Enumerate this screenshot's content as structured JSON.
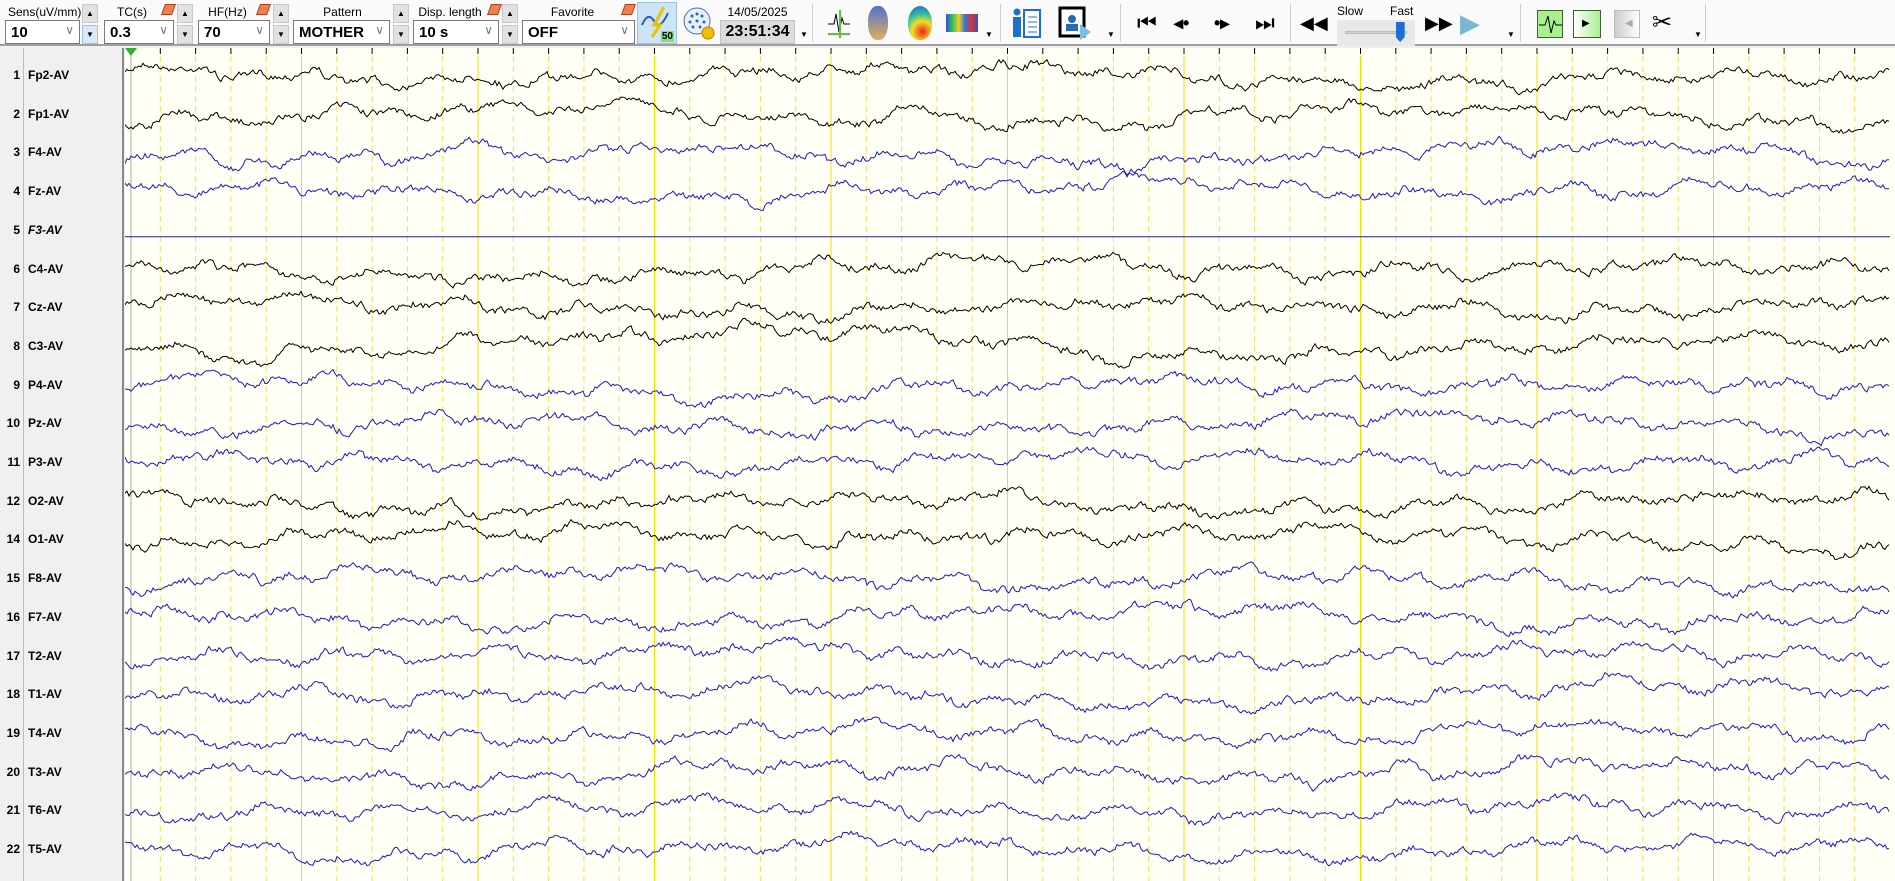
{
  "toolbar": {
    "sens": {
      "label": "Sens(uV/mm)",
      "value": "10"
    },
    "tc": {
      "label": "TC(s)",
      "value": "0.3"
    },
    "hf": {
      "label": "HF(Hz)",
      "value": "70"
    },
    "pattern": {
      "label": "Pattern",
      "value": "MOTHER"
    },
    "disp_length": {
      "label": "Disp. length",
      "value": "10 s"
    },
    "favorite": {
      "label": "Favorite",
      "value": "OFF"
    },
    "notch_badge": "50",
    "date": "14/05/2025",
    "time": "23:51:34",
    "speed": {
      "slow_label": "Slow",
      "fast_label": "Fast",
      "value_fraction": 0.85
    }
  },
  "channels": [
    {
      "num": "1",
      "name": "Fp2-AV",
      "color": "#000000"
    },
    {
      "num": "2",
      "name": "Fp1-AV",
      "color": "#000000"
    },
    {
      "num": "3",
      "name": "F4-AV",
      "color": "#1a1acc"
    },
    {
      "num": "4",
      "name": "Fz-AV",
      "color": "#1a1acc"
    },
    {
      "num": "5",
      "name": "F3-AV",
      "color": "#1a1a99",
      "flat": true
    },
    {
      "num": "6",
      "name": "C4-AV",
      "color": "#000000"
    },
    {
      "num": "7",
      "name": "Cz-AV",
      "color": "#000000"
    },
    {
      "num": "8",
      "name": "C3-AV",
      "color": "#000000"
    },
    {
      "num": "9",
      "name": "P4-AV",
      "color": "#1a1acc"
    },
    {
      "num": "10",
      "name": "Pz-AV",
      "color": "#1a1acc"
    },
    {
      "num": "11",
      "name": "P3-AV",
      "color": "#1a1acc"
    },
    {
      "num": "12",
      "name": "O2-AV",
      "color": "#000000"
    },
    {
      "num": "14",
      "name": "O1-AV",
      "color": "#000000"
    },
    {
      "num": "15",
      "name": "F8-AV",
      "color": "#1a1acc"
    },
    {
      "num": "16",
      "name": "F7-AV",
      "color": "#1a1acc"
    },
    {
      "num": "17",
      "name": "T2-AV",
      "color": "#1a1acc"
    },
    {
      "num": "18",
      "name": "T1-AV",
      "color": "#1a1acc"
    },
    {
      "num": "19",
      "name": "T4-AV",
      "color": "#1a1acc"
    },
    {
      "num": "20",
      "name": "T3-AV",
      "color": "#1a1acc"
    },
    {
      "num": "21",
      "name": "T6-AV",
      "color": "#1a1acc"
    },
    {
      "num": "22",
      "name": "T5-AV",
      "color": "#1a1acc"
    }
  ],
  "display_seconds": 10
}
